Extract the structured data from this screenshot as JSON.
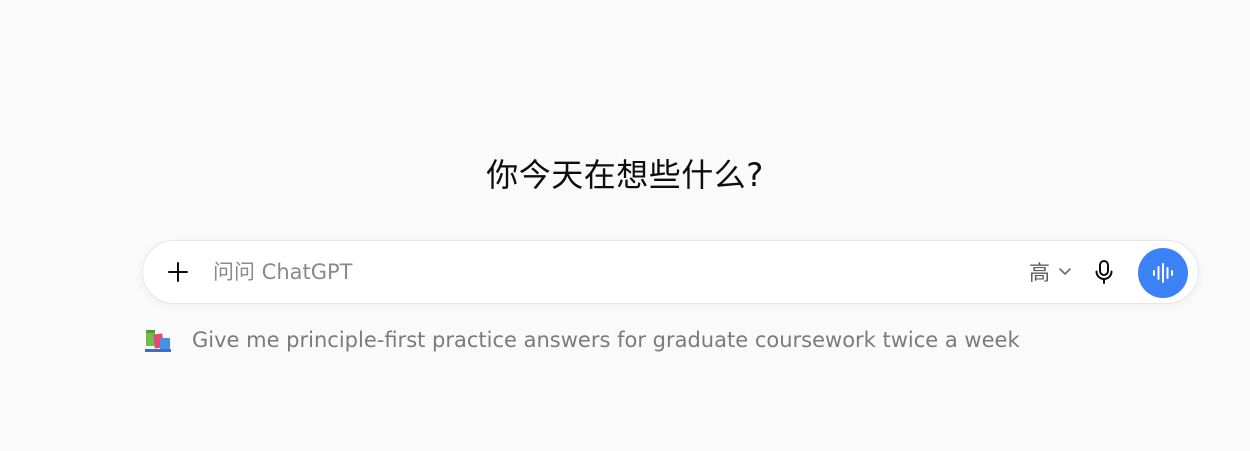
{
  "heading": "你今天在想些什么?",
  "composer": {
    "placeholder": "问问 ChatGPT",
    "value": "",
    "model_label": "高",
    "icons": {
      "attach": "plus-icon",
      "model_dropdown": "chevron-down-icon",
      "dictate": "microphone-icon",
      "voice_mode": "sound-wave-icon"
    },
    "voice_button_color": "#3b82f6"
  },
  "suggestion": {
    "icon": "books-icon",
    "text": "Give me principle-first practice answers for graduate coursework twice a week"
  }
}
